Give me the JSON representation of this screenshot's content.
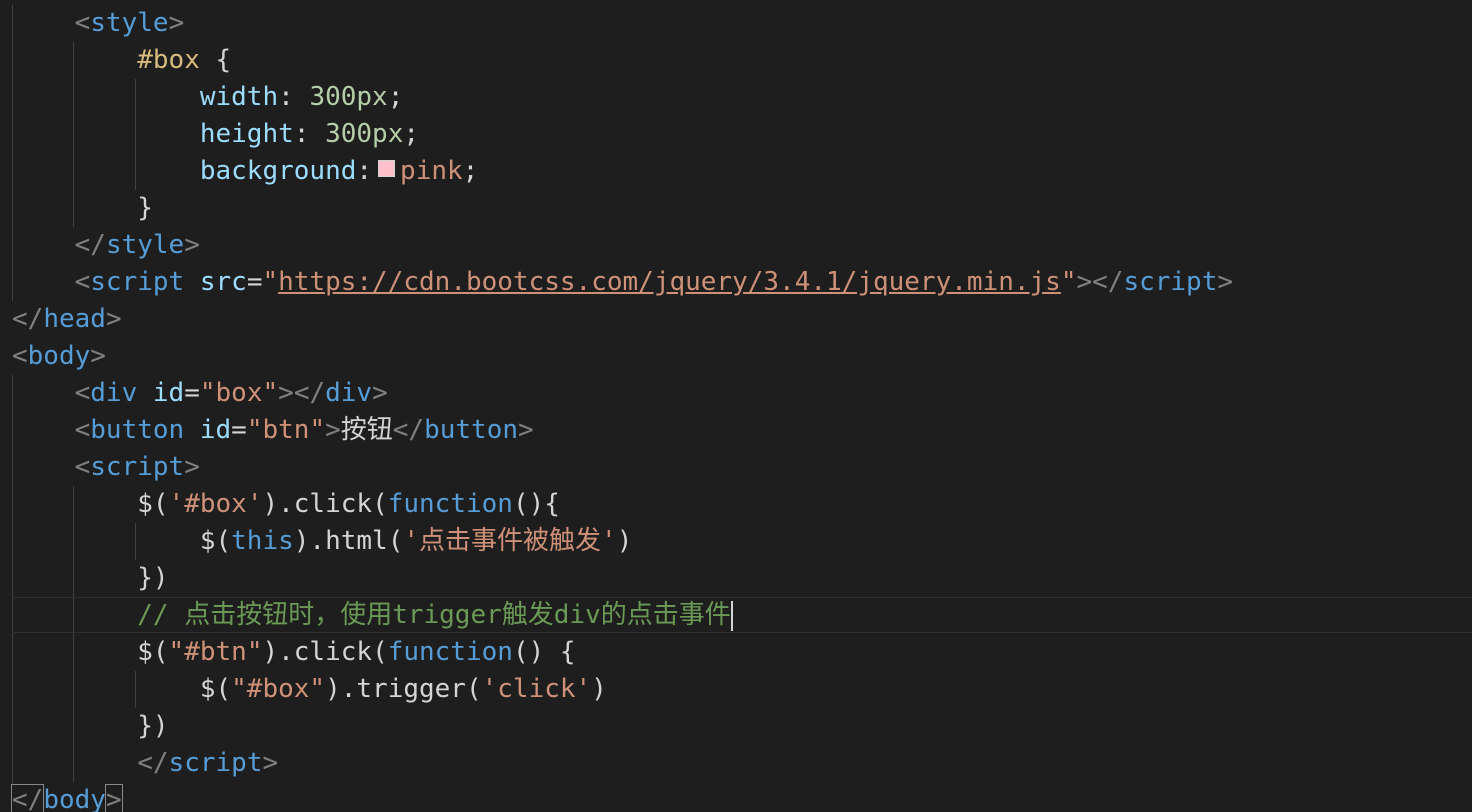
{
  "colors": {
    "background": "#1e1e1e",
    "tag": "#569cd6",
    "attribute": "#9cdcfe",
    "string": "#ce9178",
    "selector": "#d7ba7d",
    "number": "#b5cea8",
    "comment": "#6a9955",
    "swatch_pink": "#ffc0cb"
  },
  "code": {
    "l1": {
      "lt": "<",
      "tag": "style",
      "gt": ">"
    },
    "l2": {
      "sel": "#box",
      "brace": " {"
    },
    "l3": {
      "prop": "width",
      "colon": ": ",
      "num": "300px",
      "semi": ";"
    },
    "l4": {
      "prop": "height",
      "colon": ": ",
      "num": "300px",
      "semi": ";"
    },
    "l5": {
      "prop": "background",
      "colon": ":",
      "val": "pink",
      "semi": ";"
    },
    "l6": {
      "brace": "}"
    },
    "l7": {
      "lt": "</",
      "tag": "style",
      "gt": ">"
    },
    "l8": {
      "lt": "<",
      "tag": "script",
      "attr": "src",
      "eq": "=",
      "q1": "\"",
      "url": "https://cdn.bootcss.com/jquery/3.4.1/jquery.min.js",
      "q2": "\"",
      "gt": ">",
      "lt2": "</",
      "tag2": "script",
      "gt2": ">"
    },
    "l9": {
      "lt": "</",
      "tag": "head",
      "gt": ">"
    },
    "l10": {
      "lt": "<",
      "tag": "body",
      "gt": ">"
    },
    "l11": {
      "lt": "<",
      "tag": "div",
      "attr": "id",
      "eq": "=",
      "val": "\"box\"",
      "gt": ">",
      "lt2": "</",
      "tag2": "div",
      "gt2": ">"
    },
    "l12": {
      "lt": "<",
      "tag": "button",
      "attr": "id",
      "eq": "=",
      "val": "\"btn\"",
      "gt": ">",
      "text": "按钮",
      "lt2": "</",
      "tag2": "button",
      "gt2": ">"
    },
    "l13": {
      "lt": "<",
      "tag": "script",
      "gt": ">"
    },
    "l14": {
      "dollar": "$(",
      "str": "'#box'",
      "p1": ").",
      "fn": "click",
      "p2": "(",
      "kw": "function",
      "p3": "(){"
    },
    "l15": {
      "dollar": "$(",
      "kw": "this",
      "p1": ").",
      "fn": "html",
      "p2": "(",
      "str": "'点击事件被触发'",
      "p3": ")"
    },
    "l16": {
      "text": "})"
    },
    "l17": {
      "comment": "// 点击按钮时，使用trigger触发div的点击事件"
    },
    "l18": {
      "dollar": "$(",
      "str": "\"#btn\"",
      "p1": ").",
      "fn": "click",
      "p2": "(",
      "kw": "function",
      "p3": "() {"
    },
    "l19": {
      "dollar": "$(",
      "str": "\"#box\"",
      "p1": ").",
      "fn": "trigger",
      "p2": "(",
      "str2": "'click'",
      "p3": ")"
    },
    "l20": {
      "text": "})"
    },
    "l21": {
      "lt": "</",
      "tag": "script",
      "gt": ">"
    },
    "l22": {
      "lt": "</",
      "tag": "body",
      "gt": ">"
    }
  }
}
